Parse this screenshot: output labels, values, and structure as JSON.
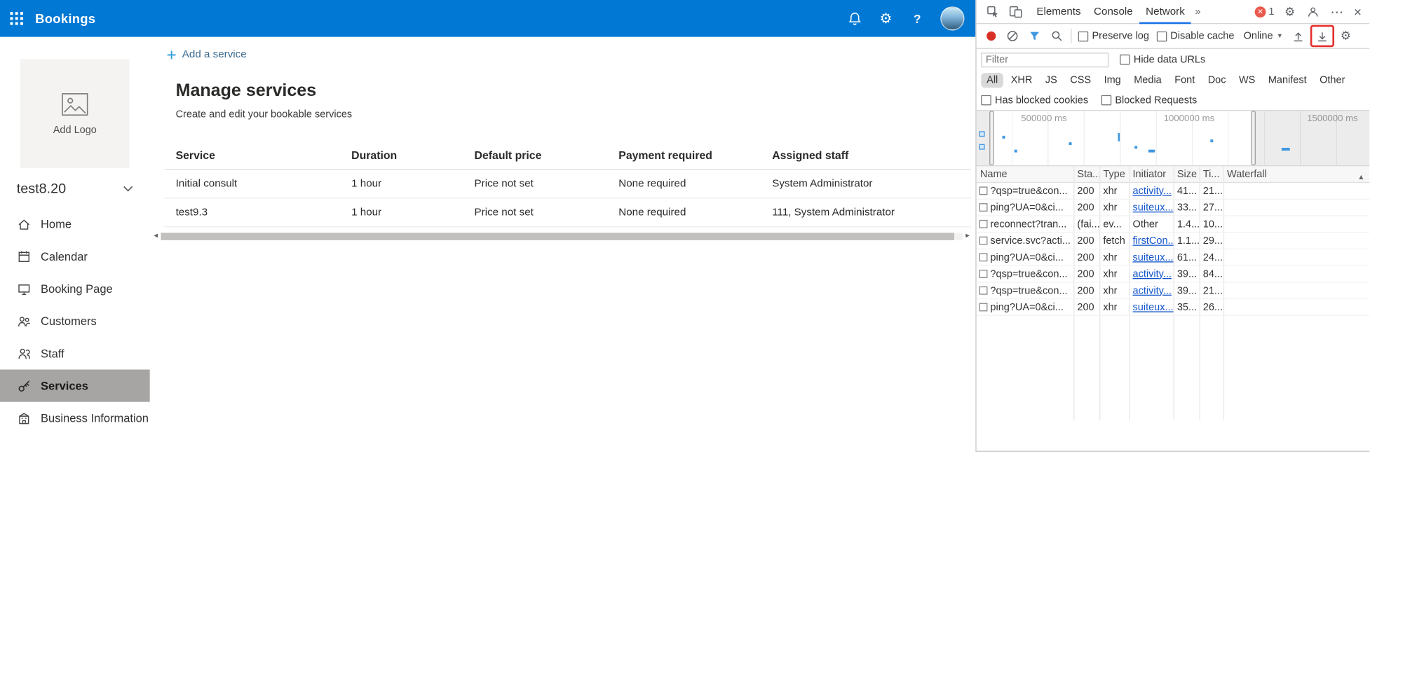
{
  "topbar": {
    "title": "Bookings"
  },
  "sidebar": {
    "logo_label": "Add Logo",
    "account_name": "test8.20",
    "items": [
      {
        "label": "Home"
      },
      {
        "label": "Calendar"
      },
      {
        "label": "Booking Page"
      },
      {
        "label": "Customers"
      },
      {
        "label": "Staff"
      },
      {
        "label": "Services"
      },
      {
        "label": "Business Information"
      }
    ]
  },
  "main": {
    "add_service_label": "Add a service",
    "heading": "Manage services",
    "subheading": "Create and edit your bookable services",
    "services_table": {
      "headers": [
        "Service",
        "Duration",
        "Default price",
        "Payment required",
        "Assigned staff"
      ],
      "rows": [
        {
          "service": "Initial consult",
          "duration": "1 hour",
          "default_price": "Price not set",
          "payment_required": "None required",
          "assigned_staff": "System Administrator"
        },
        {
          "service": "test9.3",
          "duration": "1 hour",
          "default_price": "Price not set",
          "payment_required": "None required",
          "assigned_staff": "111, System Administrator"
        }
      ]
    }
  },
  "devtools": {
    "tabs": [
      "Elements",
      "Console",
      "Network"
    ],
    "selected_tab": "Network",
    "more_tabs_glyph": "»",
    "error_badge_count": "1",
    "network_toolbar": {
      "preserve_log": "Preserve log",
      "disable_cache": "Disable cache",
      "throttling": "Online"
    },
    "filter": {
      "placeholder": "Filter",
      "hide_data_urls": "Hide data URLs"
    },
    "type_filters": [
      "All",
      "XHR",
      "JS",
      "CSS",
      "Img",
      "Media",
      "Font",
      "Doc",
      "WS",
      "Manifest",
      "Other"
    ],
    "selected_type_filter": "All",
    "checkbox_filters": {
      "has_blocked_cookies": "Has blocked cookies",
      "blocked_requests": "Blocked Requests"
    },
    "timeline": {
      "labels": [
        "500000 ms",
        "1000000 ms",
        "1500000 ms"
      ],
      "marks": [
        {
          "l": 28,
          "t": 27,
          "w": 3,
          "h": 3
        },
        {
          "l": 41,
          "t": 42,
          "w": 3,
          "h": 3
        },
        {
          "l": 100,
          "t": 34,
          "w": 3,
          "h": 3
        },
        {
          "l": 153,
          "t": 24,
          "w": 2,
          "h": 9
        },
        {
          "l": 171,
          "t": 38,
          "w": 3,
          "h": 3
        },
        {
          "l": 186,
          "t": 42,
          "w": 7,
          "h": 3
        },
        {
          "l": 253,
          "t": 31,
          "w": 3,
          "h": 3
        },
        {
          "l": 330,
          "t": 40,
          "w": 9,
          "h": 3
        }
      ]
    },
    "network_table": {
      "headers": [
        "Name",
        "Sta...",
        "Type",
        "Initiator",
        "Size",
        "Ti...",
        "Waterfall"
      ],
      "rows": [
        {
          "name": "?qsp=true&con...",
          "status": "200",
          "type": "xhr",
          "initiator": "activity...",
          "initiator_link": true,
          "size": "41...",
          "time": "21...",
          "waterfall": {
            "kind": "tick",
            "offset": 16
          }
        },
        {
          "name": "ping?UA=0&ci...",
          "status": "200",
          "type": "xhr",
          "initiator": "suiteux...",
          "initiator_link": true,
          "size": "33...",
          "time": "27...",
          "waterfall": {
            "kind": "tick",
            "offset": 40
          }
        },
        {
          "name": "reconnect?tran...",
          "status": "(fai...",
          "type": "ev...",
          "initiator": "Other",
          "initiator_link": false,
          "size": "1.4...",
          "time": "10...",
          "waterfall": {
            "kind": "bar",
            "offset": 78,
            "width": 81
          }
        },
        {
          "name": "service.svc?acti...",
          "status": "200",
          "type": "fetch",
          "initiator": "firstCon...",
          "initiator_link": true,
          "size": "1.1...",
          "time": "29...",
          "waterfall": {
            "kind": "tick",
            "offset": 80
          }
        },
        {
          "name": "ping?UA=0&ci...",
          "status": "200",
          "type": "xhr",
          "initiator": "suiteux...",
          "initiator_link": true,
          "size": "61...",
          "time": "24...",
          "waterfall": {
            "kind": "tick",
            "offset": 82
          }
        },
        {
          "name": "?qsp=true&con...",
          "status": "200",
          "type": "xhr",
          "initiator": "activity...",
          "initiator_link": true,
          "size": "39...",
          "time": "84...",
          "waterfall": {
            "kind": "tick",
            "offset": 82
          }
        },
        {
          "name": "?qsp=true&con...",
          "status": "200",
          "type": "xhr",
          "initiator": "activity...",
          "initiator_link": true,
          "size": "39...",
          "time": "21...",
          "waterfall": {
            "kind": "tick",
            "offset": 91
          }
        },
        {
          "name": "ping?UA=0&ci...",
          "status": "200",
          "type": "xhr",
          "initiator": "suiteux...",
          "initiator_link": true,
          "size": "35...",
          "time": "26...",
          "waterfall": {
            "kind": "tick",
            "offset": 125
          }
        }
      ]
    }
  },
  "icons": {
    "help_glyph": "?",
    "gear_glyph": "⚙",
    "close_glyph": "✕",
    "more_glyph": "⋯",
    "caret_down_glyph": "▼",
    "sort_asc_glyph": "▲",
    "scroll_left_glyph": "◄",
    "scroll_right_glyph": "►"
  },
  "colors": {
    "topbar_blue": "#0078d4",
    "selected_nav_gray": "#a7a5a3",
    "annotation_red": "#e4302e",
    "devtools_link_blue": "#1155cc",
    "waterfall_blue": "#4ba2f2",
    "record_red": "#d93025"
  }
}
